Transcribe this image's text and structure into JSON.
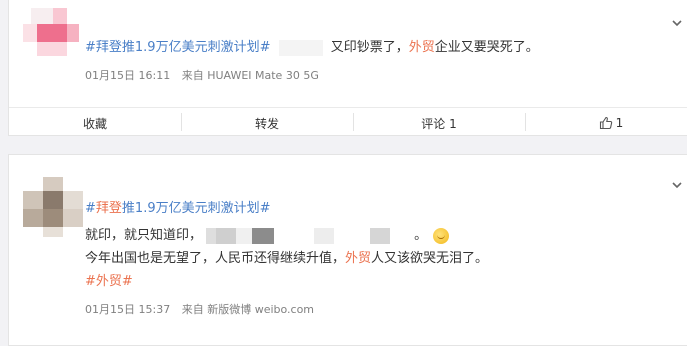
{
  "post1": {
    "topic": "#拜登推1.9万亿美元刺激计划#",
    "text_pre": "又印钞票了，",
    "highlight": "外贸",
    "text_post": "企业又要哭死了。",
    "time": "01月15日 16:11",
    "source": "来自 HUAWEI Mate 30 5G"
  },
  "actions": {
    "favorite": "收藏",
    "repost": "转发",
    "comment": "评论 1",
    "like_count": "1"
  },
  "post2": {
    "topic_hash_open": "#",
    "topic_highlight": "拜登",
    "topic_rest": "推1.9万亿美元刺激计划#",
    "line1": "就印，就只知道印，",
    "line1_end": "。",
    "line2_pre": "今年出国也是无望了，人民币还得继续升值，",
    "line2_highlight": "外贸",
    "line2_post": "人又该欲哭无泪了。",
    "tag": "#外贸#",
    "time": "01月15日 15:37",
    "source": "来自 新版微博 weibo.com"
  },
  "colors": {
    "accent": "#eb7350",
    "link": "#4a7fc7"
  },
  "icons": {
    "expand": "chevron-down-icon",
    "like": "thumbs-up-icon",
    "emoji": "smile-emoji-icon"
  }
}
